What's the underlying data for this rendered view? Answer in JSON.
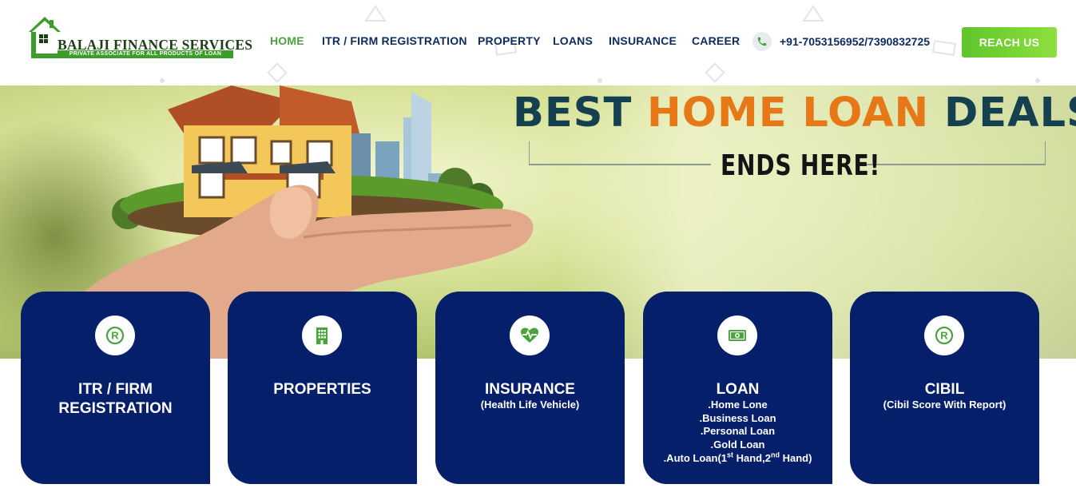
{
  "brand": {
    "name": "BALAJI FINANCE SERVICES",
    "tagline": "PRIVATE ASSOCIATE FOR ALL PRODUCTS OF LOAN"
  },
  "nav": {
    "items": [
      {
        "label": "HOME",
        "active": true
      },
      {
        "label": "ITR / FIRM REGISTRATION",
        "active": false
      },
      {
        "label": "PROPERTY",
        "active": false
      },
      {
        "label": "LOANS",
        "active": false
      },
      {
        "label": "INSURANCE",
        "active": false
      },
      {
        "label": "CAREER",
        "active": false
      }
    ],
    "phone": "+91-7053156952/7390832725",
    "cta": "REACH US"
  },
  "hero": {
    "headline_part1": "BEST",
    "headline_part2": "HOME LOAN",
    "headline_part3": "DEALS",
    "subheadline": "ENDS HERE!"
  },
  "services": [
    {
      "title": "ITR / FIRM REGISTRATION",
      "icon": "registered-icon"
    },
    {
      "title": "PROPERTIES",
      "icon": "building-icon"
    },
    {
      "title": "INSURANCE",
      "subtitle": "(Health Life Vehicle)",
      "icon": "heartbeat-icon"
    },
    {
      "title": "LOAN",
      "icon": "money-icon",
      "items": [
        ".Home Lone",
        ".Business Loan",
        ".Personal Loan",
        ".Gold Loan"
      ],
      "auto_loan": {
        "prefix": ".Auto Loan(1",
        "sup1": "st",
        "mid": " Hand,2",
        "sup2": "nd",
        "suffix": " Hand)"
      }
    },
    {
      "title": "CIBIL",
      "subtitle": "(Cibil Score With Report)",
      "icon": "registered-icon"
    }
  ],
  "colors": {
    "navy": "#051f6b",
    "nav_text": "#0d2b5e",
    "green": "#4aa33b",
    "orange": "#e67818",
    "headline_dark": "#14404f"
  }
}
